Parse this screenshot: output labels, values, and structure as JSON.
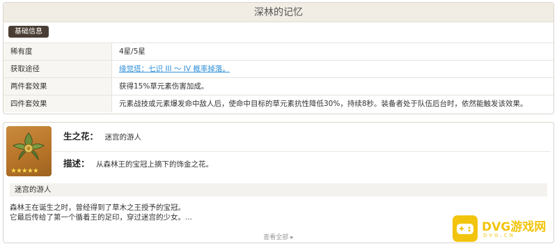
{
  "set_name": "深林的记忆",
  "tab_label": "基础信息",
  "info_rows": [
    {
      "key": "稀有度",
      "value": "4星/5星"
    },
    {
      "key": "获取途径",
      "value": "缘觉塔：七识 III ～ IV 概率掉落。"
    },
    {
      "key": "两件套效果",
      "value": "获得15%草元素伤害加成。"
    },
    {
      "key": "四件套效果",
      "value": "元素战技或元素爆发命中敌人后，使命中目标的草元素抗性降低30%，持续8秒。装备者处于队伍后台时，依然能触发该效果。"
    }
  ],
  "artifact": {
    "icon": "flower-of-life-icon",
    "stars": "★★★★★",
    "slot_label": "生之花：",
    "slot_value": "迷宫的游人",
    "desc_label": "描述：",
    "desc_value": "从森林王的宝冠上摘下的饰金之花。",
    "story_title": "迷宫的游人",
    "story_line1": "森林王在诞生之时，曾经得到了草木之王授予的宝冠。",
    "story_line2": "它最后传给了第一个循着王的足印，穿过迷宫的少女。...",
    "view_all": "查看全部 ▸"
  },
  "watermark": {
    "text": "DVG游戏网",
    "sub": "DVG.CN"
  },
  "colors": {
    "link": "#2f8fd8",
    "tab_bg": "#4a3e34",
    "header_bg": "#f1ece4",
    "watermark": "#f2c40d"
  }
}
